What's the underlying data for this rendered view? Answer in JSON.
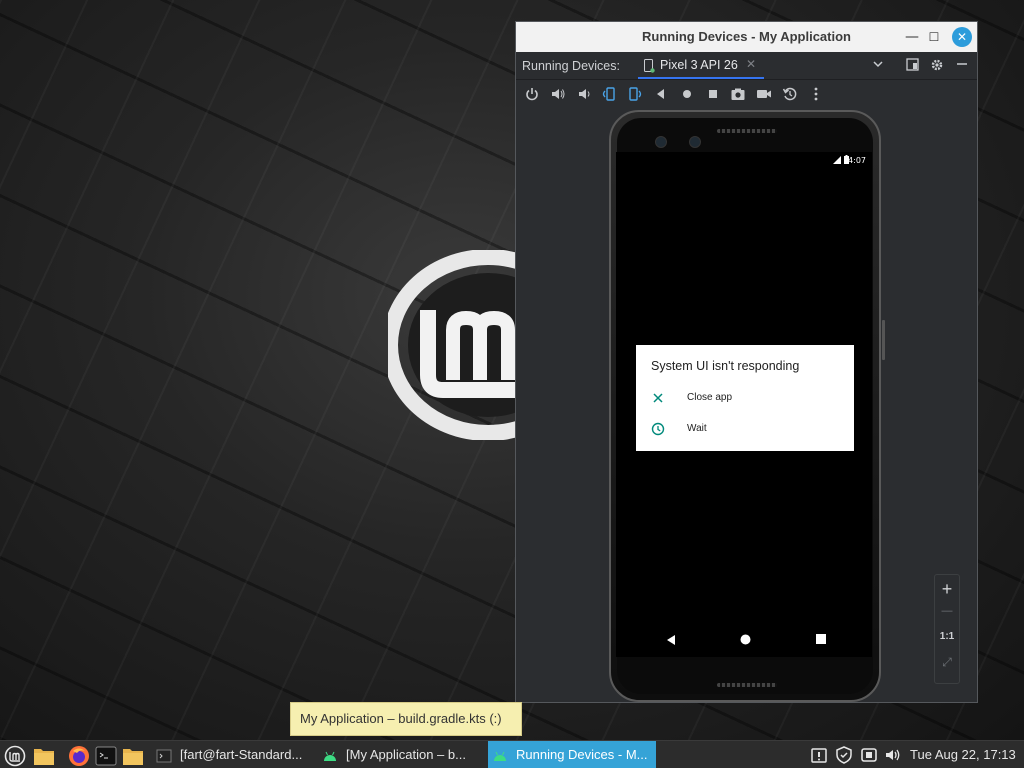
{
  "window": {
    "title": "Running Devices - My Application",
    "minimize": "—",
    "maximize": "☐",
    "close": "✕"
  },
  "tabbar": {
    "panel_label": "Running Devices:",
    "device_tab": "Pixel 3 API 26",
    "tab_close": "✕",
    "icons": [
      "chevron-down-icon",
      "split-icon",
      "gear-icon",
      "hide-icon"
    ]
  },
  "toolbar": {
    "icons": [
      "power-icon",
      "volume-up-icon",
      "volume-down-icon",
      "rotate-left-icon",
      "rotate-right-icon",
      "back-icon",
      "home-icon",
      "overview-icon",
      "screenshot-icon",
      "screen-record-icon",
      "snapshot-icon",
      "more-icon"
    ]
  },
  "phone": {
    "status_time": "4:07",
    "dialog": {
      "title": "System UI isn't responding",
      "options": [
        {
          "icon": "close-icon",
          "label": "Close app"
        },
        {
          "icon": "clock-icon",
          "label": "Wait"
        }
      ]
    }
  },
  "zoom": {
    "zoom_in": "+",
    "zoom_out": "—",
    "actual_size": "1:1",
    "fit": "⤢"
  },
  "tooltip": "My Application – build.gradle.kts (:)",
  "taskbar": {
    "tasks": [
      {
        "label": "[fart@fart-Standard..."
      },
      {
        "label": "[My Application – b..."
      },
      {
        "label": "Running Devices - M..."
      }
    ],
    "clock": "Tue Aug 22, 17:13"
  },
  "colors": {
    "accent": "#35a3d7",
    "tab_underline": "#3574f0",
    "dialog_icon": "#00897b",
    "tooltip_bg": "#f6efb0"
  }
}
